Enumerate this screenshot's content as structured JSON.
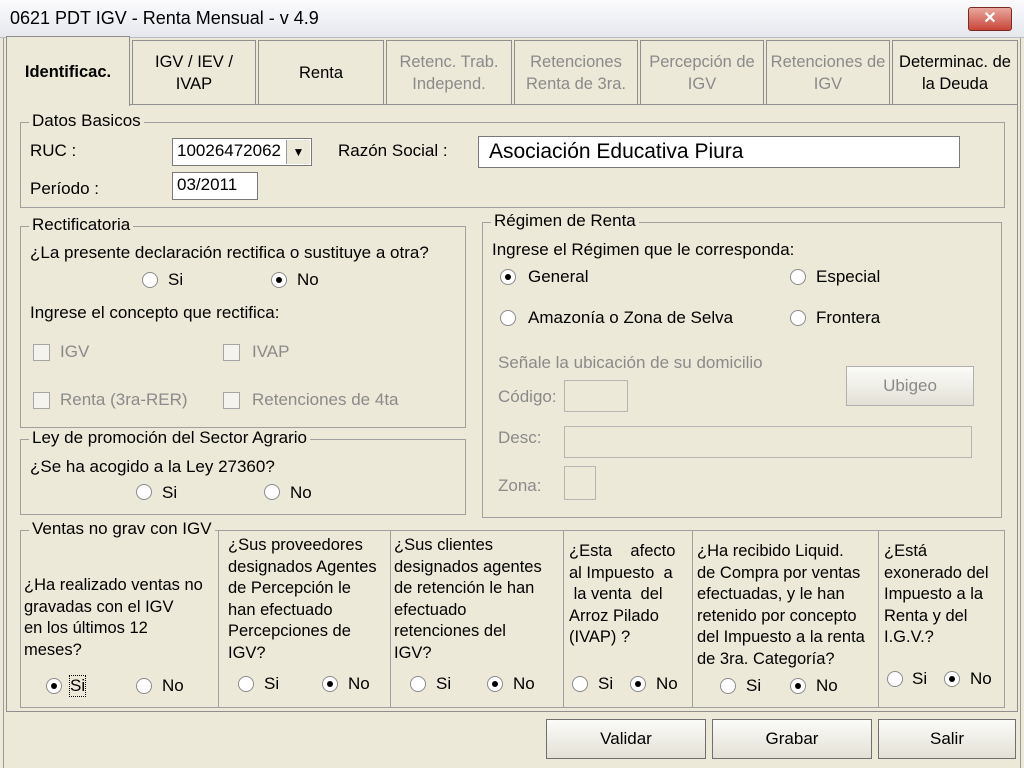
{
  "window": {
    "title": "0621 PDT IGV - Renta Mensual - v 4.9"
  },
  "tabs": [
    {
      "label": "Identificac.",
      "active": true
    },
    {
      "line1": "IGV / IEV /",
      "line2": "IVAP"
    },
    {
      "label": "Renta"
    },
    {
      "line1": "Retenc. Trab.",
      "line2": "Independ."
    },
    {
      "line1": "Retenciones",
      "line2": "Renta de 3ra."
    },
    {
      "line1": "Percepción de",
      "line2": "IGV"
    },
    {
      "line1": "Retenciones de",
      "line2": "IGV"
    },
    {
      "line1": "Determinac. de",
      "line2": "la Deuda"
    }
  ],
  "datos": {
    "legend": "Datos  Basicos",
    "ruc_label": "RUC :",
    "ruc_value": "10026472062",
    "razon_label": "Razón Social :",
    "razon_value": "Asociación Educativa Piura",
    "periodo_label": "Período :",
    "periodo_value": "03/2011"
  },
  "rectificatoria": {
    "legend": "Rectificatoria",
    "question": "¿La presente declaración rectifica o sustituye a otra?",
    "si": "Si",
    "no": "No",
    "concepto_label": "Ingrese el concepto que rectifica:",
    "checks": [
      "IGV",
      "IVAP",
      "Renta (3ra-RER)",
      "Retenciones de 4ta"
    ]
  },
  "regimen": {
    "legend": "Régimen de Renta",
    "prompt": "Ingrese el Régimen que le corresponda:",
    "general": "General",
    "especial": "Especial",
    "amazonia": "Amazonía o Zona de Selva",
    "frontera": "Frontera",
    "ubicacion": "Señale la ubicación de su domicilio",
    "codigo_label": "Código:",
    "ubigeo_button": "Ubigeo",
    "desc_label": "Desc:",
    "zona_label": "Zona:"
  },
  "agrario": {
    "legend": "Ley de promoción del Sector Agrario",
    "question": "¿Se ha acogido a la Ley 27360?",
    "si": "Si",
    "no": "No"
  },
  "ventas": {
    "legend": "Ventas no grav con IGV",
    "q1": [
      "¿Ha realizado ventas no",
      "gravadas   con el IGV",
      "en los últimos 12",
      "meses?"
    ],
    "q2": [
      "¿Sus proveedores",
      "designados Agentes",
      "de Percepción le",
      "han efectuado",
      "Percepciones de",
      "IGV?"
    ],
    "q3": [
      "¿Sus clientes",
      "designados agentes",
      "de retención le han",
      "efectuado",
      "retenciones del",
      "IGV?"
    ],
    "q4": [
      "¿Esta    afecto",
      "al Impuesto  a",
      " la venta  del",
      "Arroz Pilado",
      "(IVAP) ?"
    ],
    "q5": [
      "¿Ha recibido Liquid.",
      "de Compra por ventas",
      "efectuadas, y le han",
      "retenido por concepto",
      "del Impuesto a la renta",
      "de 3ra. Categoría?"
    ],
    "q6": [
      "¿Está",
      "exonerado del",
      "Impuesto a la",
      "Renta y del",
      "I.G.V.?"
    ],
    "si": "Si",
    "no": "No"
  },
  "buttons": {
    "validar": "Validar",
    "grabar": "Grabar",
    "salir": "Salir"
  }
}
